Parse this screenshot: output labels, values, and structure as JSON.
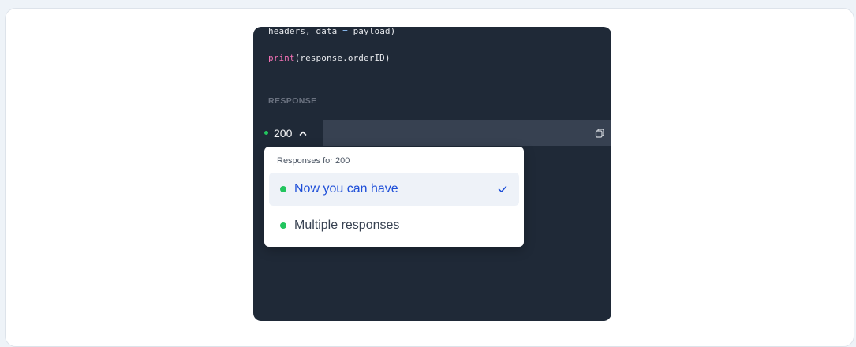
{
  "code": {
    "line1_args": "headers, data ",
    "line1_op": "=",
    "line1_rest": " payload)",
    "line2_fn": "print",
    "line2_rest": "(response.orderID)"
  },
  "response_section": {
    "label": "RESPONSE",
    "status_code": "200"
  },
  "dropdown": {
    "header": "Responses for 200",
    "options": [
      {
        "label": "Now you can have",
        "selected": true
      },
      {
        "label": "Multiple responses",
        "selected": false
      }
    ]
  },
  "colors": {
    "panel_bg": "#1f2937",
    "status_bar_bg": "#374151",
    "success_dot": "#22c55e",
    "selected_text": "#1d4ed8",
    "selected_bg": "#eef2f8"
  },
  "icons": {
    "status_toggle": "chevron-up-icon",
    "copy": "copy-icon",
    "selected_check": "check-icon"
  }
}
